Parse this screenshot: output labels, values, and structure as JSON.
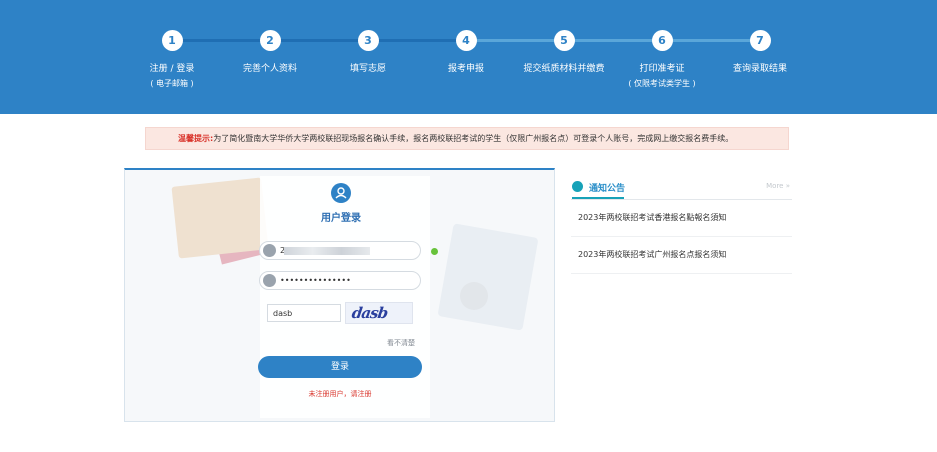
{
  "steps": [
    {
      "num": "1",
      "label": "注册 / 登录",
      "sub": "( 电子邮箱 )"
    },
    {
      "num": "2",
      "label": "完善个人资料",
      "sub": ""
    },
    {
      "num": "3",
      "label": "填写志愿",
      "sub": ""
    },
    {
      "num": "4",
      "label": "报考申报",
      "sub": ""
    },
    {
      "num": "5",
      "label": "提交纸质材料并缴费",
      "sub": ""
    },
    {
      "num": "6",
      "label": "打印准考证",
      "sub": "( 仅限考试类学生 )"
    },
    {
      "num": "7",
      "label": "查询录取结果",
      "sub": ""
    }
  ],
  "notice": {
    "label": "温馨提示:",
    "text": "为了简化暨南大学华侨大学两校联招现场报名确认手续，报名两校联招考试的学生（仅限广州报名点）可登录个人账号，完成网上缴交报名费手续。"
  },
  "login": {
    "title": "用户登录",
    "username_value": "2",
    "password_value": "•••••••••••••••",
    "captcha_value": "dasb",
    "captcha_image_text": "dasb",
    "refresh_label": "看不清楚",
    "submit_label": "登录",
    "register_link": "未注册用户，请注册"
  },
  "news": {
    "title": "通知公告",
    "more": "More »",
    "items": [
      "2023年两校联招考试香港报名點報名須知",
      "2023年两校联招考试广州报名点报名须知"
    ]
  },
  "colors": {
    "brand": "#2e82c6",
    "alert": "#d9342b",
    "teal": "#17a2b8",
    "success": "#67c23a"
  }
}
